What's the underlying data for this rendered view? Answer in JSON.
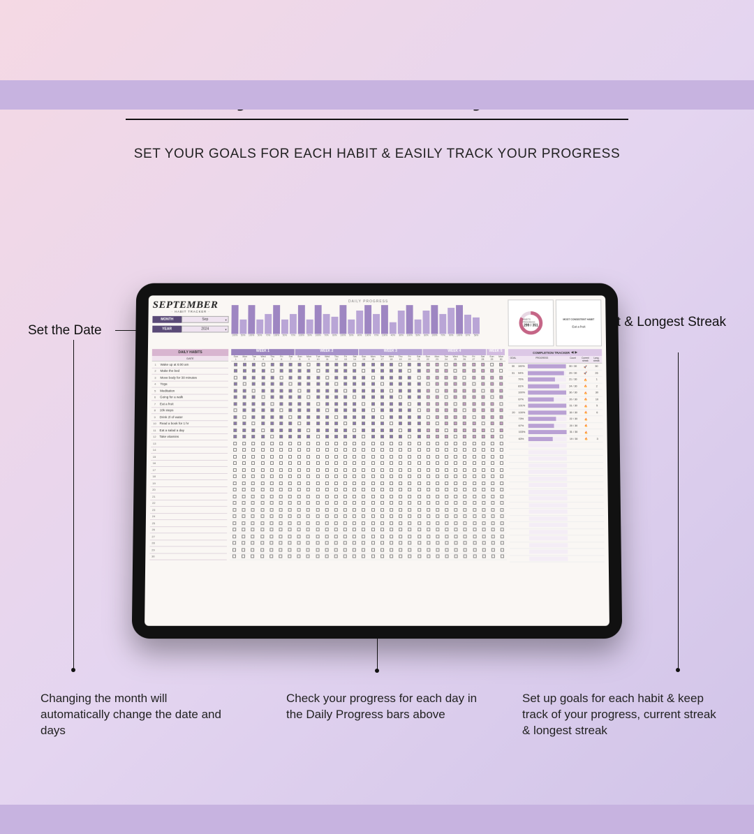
{
  "title": "Easily Track Your Daily Habits",
  "subtitle": "SET YOUR GOALS FOR EACH HABIT & EASILY TRACK YOUR PROGRESS",
  "annotations": {
    "left_label": "Set the Date",
    "right_label": "Current & Longest Streak",
    "caption_left": "Changing the month will automatically change the date and days",
    "caption_mid": "Check your progress for each day in the Daily Progress bars above",
    "caption_right": "Set up goals for each habit & keep track of your progress, current streak & longest streak"
  },
  "header": {
    "month_name": "SEPTEMBER",
    "month_sub": "· HABIT TRACKER ·",
    "month_select_label": "MONTH",
    "month_select_value": "Sep",
    "year_select_label": "YEAR",
    "year_select_value": "2024",
    "chart_title": "DAILY PROGRESS",
    "donut_title": "HABITS PROGRESS",
    "donut_value": "299 / 351",
    "consistent_title": "MOST CONSISTENT HABIT",
    "consistent_value": "Eat a fruit"
  },
  "chart_data": {
    "type": "bar",
    "title": "DAILY PROGRESS",
    "categories": [
      "1",
      "2",
      "3",
      "4",
      "5",
      "6",
      "7",
      "8",
      "9",
      "10",
      "11",
      "12",
      "13",
      "14",
      "15",
      "16",
      "17",
      "18",
      "19",
      "20",
      "21",
      "22",
      "23",
      "24",
      "25",
      "26",
      "27",
      "28",
      "29",
      "30"
    ],
    "values_pct": [
      100,
      50,
      100,
      50,
      70,
      100,
      50,
      70,
      100,
      50,
      100,
      70,
      60,
      100,
      50,
      80,
      100,
      70,
      100,
      40,
      80,
      100,
      50,
      80,
      100,
      70,
      90,
      100,
      67,
      58
    ],
    "labels_pct": [
      "100%",
      "50%",
      "100%",
      "50%",
      "70%",
      "100%",
      "50%",
      "70%",
      "100%",
      "50%",
      "100%",
      "70%",
      "60%",
      "100%",
      "50%",
      "80%",
      "100%",
      "70%",
      "100%",
      "40%",
      "80%",
      "100%",
      "50%",
      "80%",
      "100%",
      "70%",
      "90%",
      "100%",
      "67%",
      "58%"
    ],
    "ylim": [
      0,
      100
    ]
  },
  "habits": {
    "header": "DAILY HABITS",
    "sub": "DATE",
    "items": [
      "Wake up at 6:00 am",
      "Make the bed",
      "Move body for 30 minutes",
      "Yoga",
      "Meditation",
      "Going for a walk",
      "Eat a fruit",
      "10k steps",
      "Drink 2l of water",
      "Read a book for 1 hr",
      "Eat a salad a day",
      "Take vitamins"
    ],
    "total_rows": 30
  },
  "weeks": {
    "labels": [
      "WEEK 1",
      "WEEK 2",
      "WEEK 3",
      "WEEK 4",
      "WEEK 5"
    ],
    "dow": [
      "Sun",
      "Mon",
      "Tue",
      "Wed",
      "Thu",
      "Fri",
      "Sat",
      "Sun",
      "Mon",
      "Tue",
      "Wed",
      "Thu",
      "Fri",
      "Sat",
      "Sun",
      "Mon",
      "Tue",
      "Wed",
      "Thu",
      "Fri",
      "Sat",
      "Sun",
      "Mon",
      "Tue",
      "Wed",
      "Thu",
      "Fri",
      "Sat",
      "Sun",
      "Mon"
    ],
    "nums": [
      "1",
      "2",
      "3",
      "4",
      "5",
      "6",
      "7",
      "8",
      "9",
      "10",
      "11",
      "12",
      "13",
      "14",
      "15",
      "16",
      "17",
      "18",
      "19",
      "20",
      "21",
      "22",
      "23",
      "24",
      "25",
      "26",
      "27",
      "28",
      "29",
      "30"
    ]
  },
  "tracker": {
    "header": "COMPLETION TRACKER",
    "cols": {
      "goal": "GOAL",
      "progress": "PROGRESS",
      "count": "Count",
      "current": "Current streak",
      "longest": "Long. streak"
    },
    "rows": [
      {
        "goal": "30",
        "pct": "100%",
        "bar": 100,
        "count": "30 / 30",
        "cur": "🚀",
        "ls": "30"
      },
      {
        "goal": "31",
        "pct": "94%",
        "bar": 94,
        "count": "29 / 30",
        "cur": "🚀",
        "ls": "26"
      },
      {
        "goal": "",
        "pct": "70%",
        "bar": 70,
        "count": "21 / 30",
        "cur": "🔥",
        "ls": "1"
      },
      {
        "goal": "",
        "pct": "81%",
        "bar": 81,
        "count": "24 / 30",
        "cur": "🔥",
        "ls": "2"
      },
      {
        "goal": "",
        "pct": "100%",
        "bar": 100,
        "count": "30 / 30",
        "cur": "🔥",
        "ls": "30"
      },
      {
        "goal": "",
        "pct": "67%",
        "bar": 67,
        "count": "20 / 30",
        "cur": "🔥",
        "ls": "10"
      },
      {
        "goal": "",
        "pct": "101%",
        "bar": 100,
        "count": "31 / 30",
        "cur": "🔥",
        "ls": "5"
      },
      {
        "goal": "20",
        "pct": "100%",
        "bar": 100,
        "count": "30 / 30",
        "cur": "🔥",
        "ls": "6"
      },
      {
        "goal": "",
        "pct": "73%",
        "bar": 73,
        "count": "22 / 30",
        "cur": "🔥",
        "ls": ""
      },
      {
        "goal": "",
        "pct": "67%",
        "bar": 67,
        "count": "20 / 30",
        "cur": "🔥",
        "ls": ""
      },
      {
        "goal": "",
        "pct": "103%",
        "bar": 100,
        "count": "31 / 30",
        "cur": "🔥",
        "ls": ""
      },
      {
        "goal": "",
        "pct": "63%",
        "bar": 63,
        "count": "19 / 30",
        "cur": "🔥",
        "ls": "3"
      }
    ]
  }
}
